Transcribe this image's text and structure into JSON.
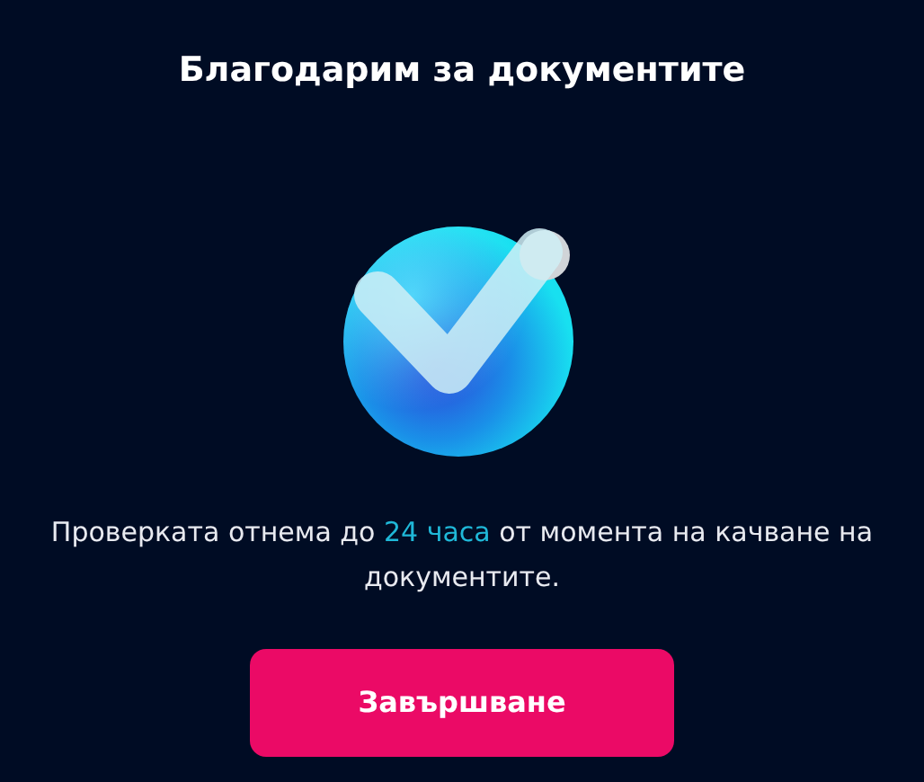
{
  "title": "Благодарим за документите",
  "message": [
    {
      "text": "Проверката отнема до ",
      "highlight": false
    },
    {
      "text": "24 часа",
      "highlight": true
    },
    {
      "text": " от момента на качване на документите.",
      "highlight": false
    }
  ],
  "button": {
    "label": "Завършване"
  }
}
